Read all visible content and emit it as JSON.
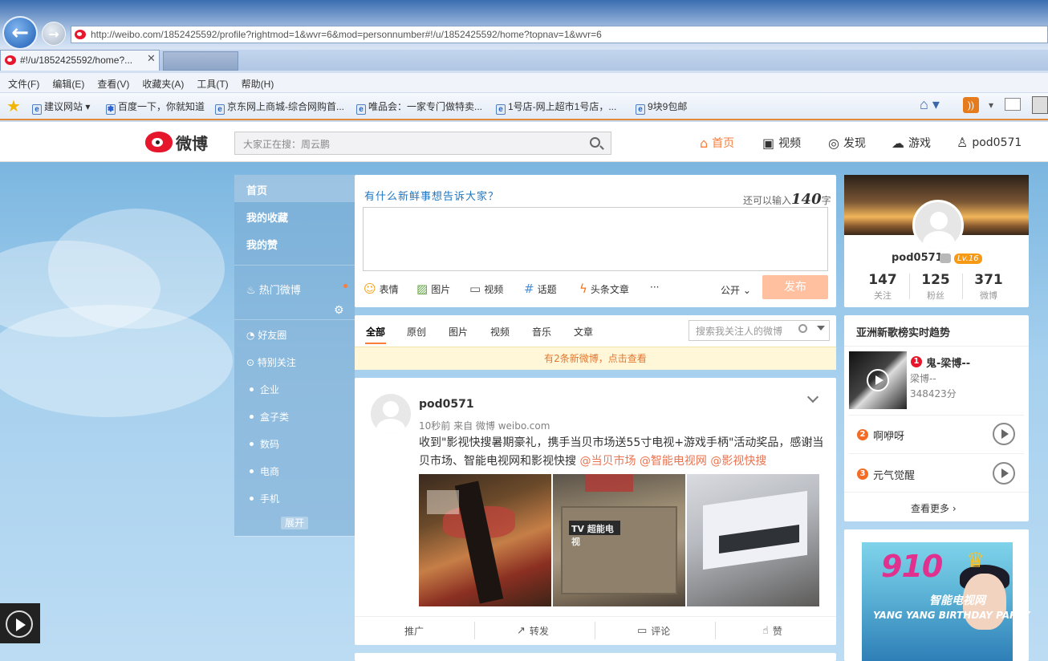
{
  "browser": {
    "url": "http://weibo.com/1852425592/profile?rightmod=1&wvr=6&mod=personnumber#!/u/1852425592/home?topnav=1&wvr=6",
    "active_tab": "#!/u/1852425592/home?...",
    "menu": [
      "文件(F)",
      "编辑(E)",
      "查看(V)",
      "收藏夹(A)",
      "工具(T)",
      "帮助(H)"
    ],
    "favorites": [
      "建议网站",
      "百度一下，你就知道",
      "京东网上商城-综合网购首...",
      "唯品会：一家专门做特卖...",
      "1号店-网上超市1号店，...",
      "9块9包邮"
    ]
  },
  "weibo_nav": {
    "logo": "微博",
    "search_placeholder": "大家正在搜：周云鹏",
    "items": [
      "首页",
      "视频",
      "发现",
      "游戏",
      "pod0571"
    ],
    "accent": "#fa7d3c"
  },
  "left_nav": {
    "home": "首页",
    "favorites": "我的收藏",
    "likes": "我的赞",
    "hot": "热门微博",
    "friends": "好友圈",
    "special": "特别关注",
    "groups": [
      "企业",
      "盒子类",
      "数码",
      "电商",
      "手机"
    ],
    "expand": "展开"
  },
  "composer": {
    "title": "有什么新鲜事想告诉大家？",
    "remain_prefix": "还可以输入",
    "remain_count": "140",
    "remain_suffix": "字",
    "tools": [
      "表情",
      "图片",
      "视频",
      "话题",
      "头条文章"
    ],
    "more": "···",
    "scope": "公开",
    "publish": "发布"
  },
  "filter": {
    "tabs": [
      "全部",
      "原创",
      "图片",
      "视频",
      "音乐",
      "文章"
    ],
    "search_placeholder": "搜索我关注人的微博",
    "new_notice": "有2条新微博，点击查看"
  },
  "feed": {
    "user": "pod0571",
    "meta": "10秒前 来自 微博 weibo.com",
    "text": "收到\"影视快搜暑期豪礼，携手当贝市场送55寸电视+游戏手柄\"活动奖品，感谢当贝市场、智能电视网和影视快搜 ",
    "mentions": [
      "@当贝市场",
      "@智能电视网",
      "@影视快搜"
    ],
    "actions": [
      "推广",
      "转发",
      "评论",
      "赞"
    ]
  },
  "profile": {
    "name": "pod0571",
    "level": "Lv.16",
    "stats": [
      {
        "num": "147",
        "label": "关注"
      },
      {
        "num": "125",
        "label": "粉丝"
      },
      {
        "num": "371",
        "label": "微博"
      }
    ]
  },
  "trend": {
    "title": "亚洲新歌榜实时趋势",
    "songs": [
      {
        "rank": "1",
        "name": "鬼-梁博--",
        "artist": "梁博--",
        "score": "348423分"
      },
      {
        "rank": "2",
        "name": "啊咿呀"
      },
      {
        "rank": "3",
        "name": "元气觉醒"
      }
    ],
    "more": "查看更多"
  },
  "promo": {
    "big": "910",
    "tag": "智能电视网",
    "bottom": "YANG YANG BIRTHDAY PARTY"
  }
}
